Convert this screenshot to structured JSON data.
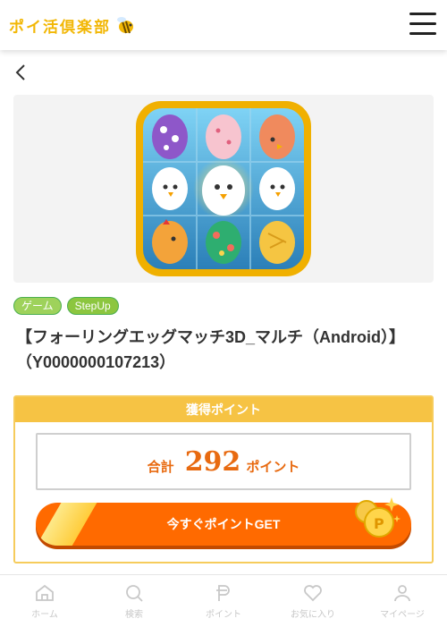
{
  "header": {
    "logo_text": "ポイ活倶楽部",
    "logo_icon": "bee-icon",
    "menu_icon": "hamburger-icon"
  },
  "nav": {
    "back_icon": "chevron-left-icon"
  },
  "offer": {
    "icon": "egg-game-app-icon",
    "tags": [
      "ゲーム",
      "StepUp"
    ],
    "title": "【フォーリングエッグマッチ3D_マルチ（Android）】（Y0000000107213）"
  },
  "points": {
    "header": "獲得ポイント",
    "total_label": "合計",
    "total_value": "292",
    "total_unit": "ポイント",
    "get_button": "今すぐポイントGET"
  },
  "tabbar": {
    "items": [
      {
        "label": "ホーム",
        "icon": "home-icon"
      },
      {
        "label": "検索",
        "icon": "search-icon"
      },
      {
        "label": "ポイント",
        "icon": "point-icon"
      },
      {
        "label": "お気に入り",
        "icon": "heart-icon"
      },
      {
        "label": "マイページ",
        "icon": "user-icon"
      }
    ]
  },
  "colors": {
    "accent_orange": "#ff6a00",
    "points_header": "#f6c344",
    "tag_green": "#8cc63f",
    "logo_yellow": "#f2b705"
  }
}
